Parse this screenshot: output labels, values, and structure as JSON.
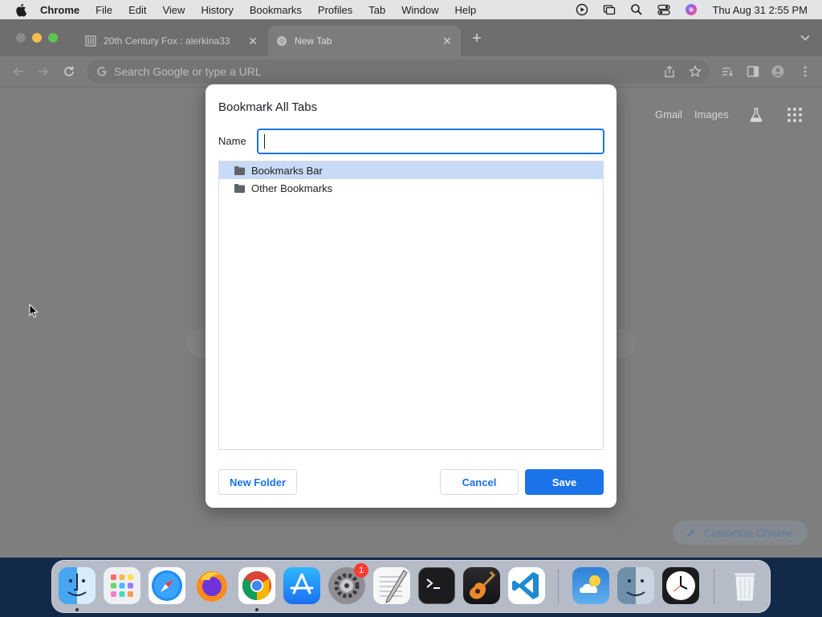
{
  "menubar": {
    "app": "Chrome",
    "items": [
      "File",
      "Edit",
      "View",
      "History",
      "Bookmarks",
      "Profiles",
      "Tab",
      "Window",
      "Help"
    ],
    "clock": "Thu Aug 31  2:55 PM"
  },
  "browser": {
    "tabs": [
      {
        "title": "20th Century Fox : alerkina33"
      },
      {
        "title": "New Tab"
      }
    ],
    "omnibox_placeholder": "Search Google or type a URL"
  },
  "newtab": {
    "gmail": "Gmail",
    "images": "Images",
    "customize": "Customize Chrome"
  },
  "dialog": {
    "title": "Bookmark All Tabs",
    "name_label": "Name",
    "name_value": "",
    "folders": [
      {
        "label": "Bookmarks Bar",
        "selected": true
      },
      {
        "label": "Other Bookmarks",
        "selected": false
      }
    ],
    "new_folder": "New Folder",
    "cancel": "Cancel",
    "save": "Save"
  },
  "dock": {
    "badge": "1"
  },
  "colors": {
    "accent": "#1a73e8",
    "selection": "#c7dbf6"
  }
}
